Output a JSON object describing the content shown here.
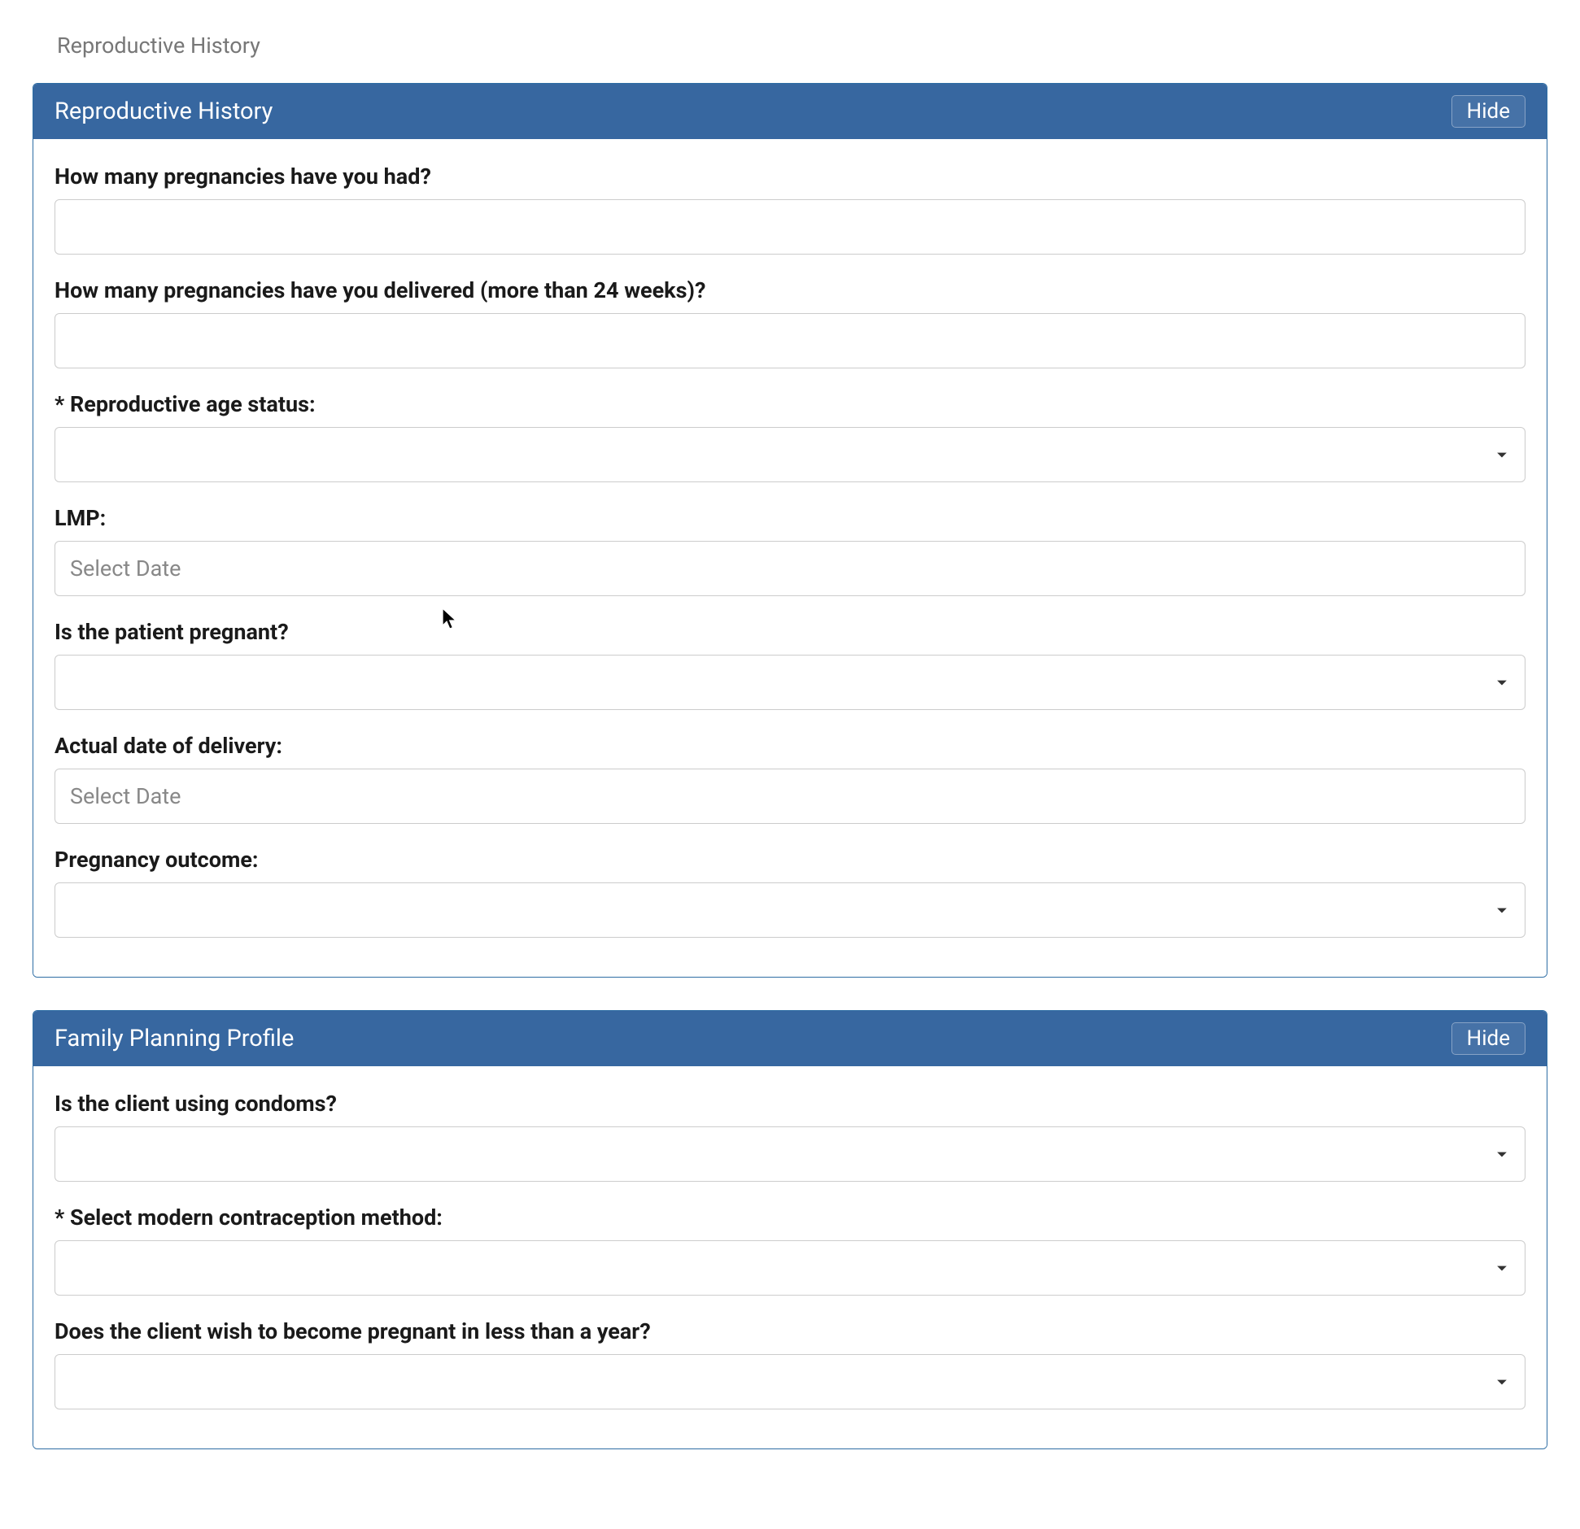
{
  "breadcrumb": "Reproductive History",
  "panels": {
    "reproductive": {
      "title": "Reproductive History",
      "hide_label": "Hide",
      "fields": {
        "pregnancies_had": {
          "label": "How many pregnancies have you had?",
          "value": ""
        },
        "pregnancies_delivered": {
          "label": "How many pregnancies have you delivered (more than 24 weeks)?",
          "value": ""
        },
        "reproductive_age_status": {
          "label": "* Reproductive age status:",
          "value": ""
        },
        "lmp": {
          "label": "LMP:",
          "placeholder": "Select Date",
          "value": ""
        },
        "is_pregnant": {
          "label": "Is the patient pregnant?",
          "value": ""
        },
        "actual_delivery_date": {
          "label": "Actual date of delivery:",
          "placeholder": "Select Date",
          "value": ""
        },
        "pregnancy_outcome": {
          "label": "Pregnancy outcome:",
          "value": ""
        }
      }
    },
    "family_planning": {
      "title": "Family Planning Profile",
      "hide_label": "Hide",
      "fields": {
        "using_condoms": {
          "label": "Is the client using condoms?",
          "value": ""
        },
        "contraception_method": {
          "label": "* Select modern contraception method:",
          "value": ""
        },
        "wish_pregnant": {
          "label": "Does the client wish to become pregnant in less than a year?",
          "value": ""
        }
      }
    }
  }
}
